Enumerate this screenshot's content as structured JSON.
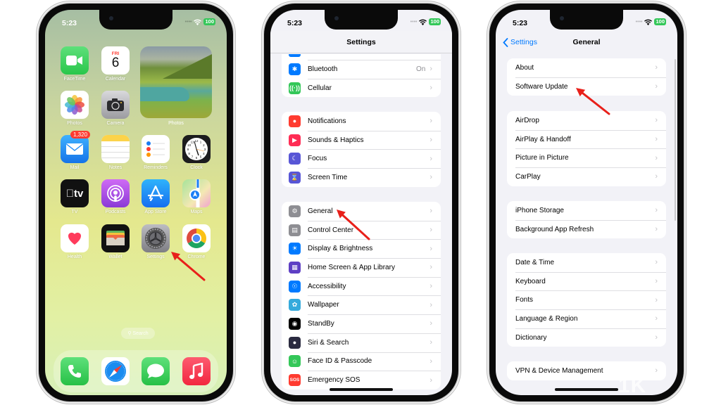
{
  "status": {
    "time": "5:23",
    "battery": "100"
  },
  "home": {
    "apps": [
      {
        "label": "FaceTime",
        "icon": "facetime-icon",
        "color": "#34c759"
      },
      {
        "label": "Calendar",
        "icon": "calendar-icon",
        "day": "FRI",
        "date": "6"
      },
      {
        "label": "Photos",
        "icon": "photos-icon"
      },
      {
        "label": "Camera",
        "icon": "camera-icon"
      },
      {
        "label": "Mail",
        "icon": "mail-icon",
        "badge": "1,320",
        "color": "#1d8cf8"
      },
      {
        "label": "Notes",
        "icon": "notes-icon"
      },
      {
        "label": "Reminders",
        "icon": "reminders-icon"
      },
      {
        "label": "Clock",
        "icon": "clock-icon"
      },
      {
        "label": "TV",
        "icon": "tv-icon",
        "glyph": "tv"
      },
      {
        "label": "Podcasts",
        "icon": "podcasts-icon",
        "color": "#a44ee8"
      },
      {
        "label": "App Store",
        "icon": "app-store-icon",
        "color": "#1c8ef9"
      },
      {
        "label": "Maps",
        "icon": "maps-icon"
      },
      {
        "label": "Health",
        "icon": "health-icon"
      },
      {
        "label": "Wallet",
        "icon": "wallet-icon"
      },
      {
        "label": "Settings",
        "icon": "settings-icon"
      },
      {
        "label": "Chrome",
        "icon": "chrome-icon"
      }
    ],
    "widget_label": "Photos",
    "search_label": "Search",
    "dock": [
      {
        "name": "Phone",
        "icon": "phone-icon"
      },
      {
        "name": "Safari",
        "icon": "safari-icon"
      },
      {
        "name": "Messages",
        "icon": "messages-icon"
      },
      {
        "name": "Music",
        "icon": "music-icon"
      }
    ]
  },
  "settings": {
    "title": "Settings",
    "groups": [
      [
        {
          "label": "Bluetooth",
          "value": "On",
          "icon": "bluetooth-icon",
          "color": "#007aff"
        },
        {
          "label": "Cellular",
          "icon": "cellular-icon",
          "color": "#34c759"
        }
      ],
      [
        {
          "label": "Notifications",
          "icon": "notifications-icon",
          "color": "#ff3b30"
        },
        {
          "label": "Sounds & Haptics",
          "icon": "sounds-icon",
          "color": "#ff2d55"
        },
        {
          "label": "Focus",
          "icon": "focus-icon",
          "color": "#5856d6"
        },
        {
          "label": "Screen Time",
          "icon": "screen-time-icon",
          "color": "#5856d6"
        }
      ],
      [
        {
          "label": "General",
          "icon": "general-gear-icon",
          "color": "#8e8e93"
        },
        {
          "label": "Control Center",
          "icon": "control-center-icon",
          "color": "#8e8e93"
        },
        {
          "label": "Display & Brightness",
          "icon": "display-icon",
          "color": "#007aff"
        },
        {
          "label": "Home Screen & App Library",
          "icon": "home-screen-icon",
          "color": "#5e3fc4"
        },
        {
          "label": "Accessibility",
          "icon": "accessibility-icon",
          "color": "#007aff"
        },
        {
          "label": "Wallpaper",
          "icon": "wallpaper-icon",
          "color": "#35aadc"
        },
        {
          "label": "StandBy",
          "icon": "standby-icon",
          "color": "#000000"
        },
        {
          "label": "Siri & Search",
          "icon": "siri-icon",
          "color": "#2b2b40"
        },
        {
          "label": "Face ID & Passcode",
          "icon": "face-id-icon",
          "color": "#34c759"
        },
        {
          "label": "Emergency SOS",
          "icon": "sos-icon",
          "color": "#ff3b30",
          "glyph": "SOS"
        }
      ]
    ]
  },
  "general": {
    "back_label": "Settings",
    "title": "General",
    "groups": [
      [
        {
          "label": "About"
        },
        {
          "label": "Software Update"
        }
      ],
      [
        {
          "label": "AirDrop"
        },
        {
          "label": "AirPlay & Handoff"
        },
        {
          "label": "Picture in Picture"
        },
        {
          "label": "CarPlay"
        }
      ],
      [
        {
          "label": "iPhone Storage"
        },
        {
          "label": "Background App Refresh"
        }
      ],
      [
        {
          "label": "Date & Time"
        },
        {
          "label": "Keyboard"
        },
        {
          "label": "Fonts"
        },
        {
          "label": "Language & Region"
        },
        {
          "label": "Dictionary"
        }
      ],
      [
        {
          "label": "VPN & Device Management"
        }
      ]
    ]
  },
  "annotation_color": "#e8201a",
  "watermark": "1K"
}
